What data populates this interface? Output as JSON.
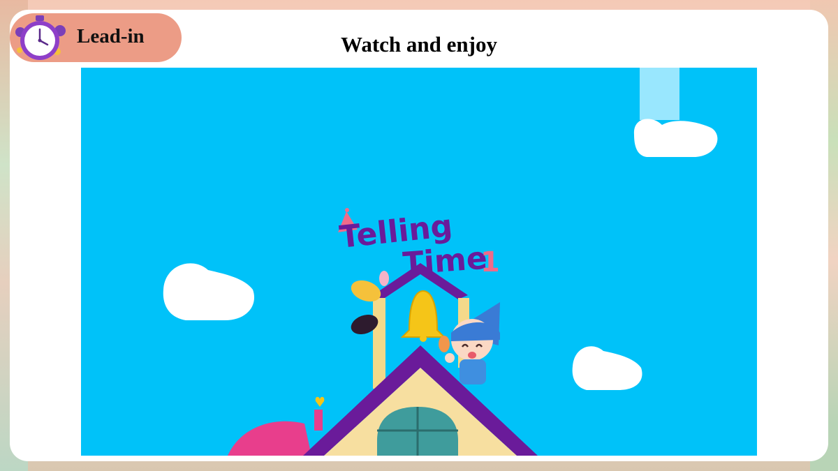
{
  "section_badge": {
    "label": "Lead-in",
    "icon": "stopwatch-icon",
    "color": "#ec9c86"
  },
  "slide": {
    "title": "Watch and enjoy"
  },
  "video": {
    "title_line1": "Telling",
    "title_line2": "Time",
    "title_number": "1",
    "sky_color": "#00c2f9",
    "title_color": "#6a1b9a"
  }
}
